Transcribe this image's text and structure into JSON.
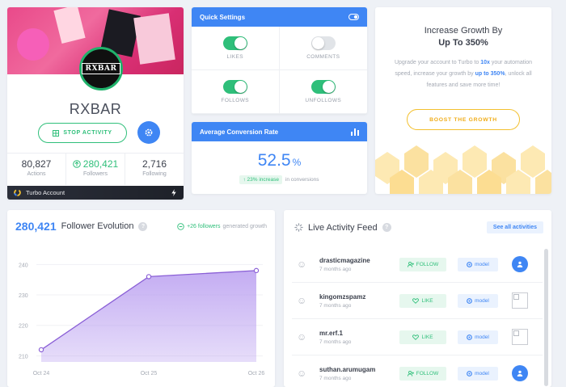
{
  "profile": {
    "logo_text": "RXBAR",
    "name": "RXBAR",
    "stop_label": "STOP ACTIVITY",
    "stats": [
      {
        "value": "80,827",
        "label": "Actions"
      },
      {
        "value": "280,421",
        "label": "Followers"
      },
      {
        "value": "2,716",
        "label": "Following"
      }
    ],
    "turbo_label": "Turbo Account"
  },
  "quick_settings": {
    "title": "Quick Settings",
    "toggles": [
      {
        "label": "LIKES",
        "on": true
      },
      {
        "label": "COMMENTS",
        "on": false
      },
      {
        "label": "FOLLOWS",
        "on": true
      },
      {
        "label": "UNFOLLOWS",
        "on": true
      }
    ]
  },
  "conversion": {
    "title": "Average Conversion Rate",
    "value": "52.5",
    "unit": "%",
    "increase": "23% increase",
    "increase_suffix": "in conversions"
  },
  "upgrade": {
    "title_line1": "Increase Growth By",
    "title_line2": "Up To 350%",
    "text_a": "Upgrade your account to Turbo to ",
    "text_b": "10x",
    "text_c": " your automation speed, increase your growth by ",
    "text_d": "up to 350%",
    "text_e": ", unlock all features and save more time!",
    "button": "BOOST THE GROWTH"
  },
  "evolution": {
    "count": "280,421",
    "title": "Follower Evolution",
    "growth_value": "+26 followers",
    "growth_suffix": "generated growth"
  },
  "chart_data": {
    "type": "area",
    "x": [
      "Oct 24",
      "Oct 25",
      "Oct 26"
    ],
    "values": [
      212,
      236,
      238
    ],
    "yticks": [
      210,
      220,
      230,
      240
    ],
    "ylim": [
      208,
      243
    ],
    "colors": {
      "line": "#8a5fd6",
      "fill": "#b99ef0"
    }
  },
  "feed": {
    "title": "Live Activity Feed",
    "see_all": "See all activities",
    "items": [
      {
        "user": "drasticmagazine",
        "time": "7 months ago",
        "action": "FOLLOW",
        "tag": "model",
        "avatar": "user"
      },
      {
        "user": "kingomzspamz",
        "time": "7 months ago",
        "action": "LIKE",
        "tag": "model",
        "avatar": "image"
      },
      {
        "user": "mr.erf.1",
        "time": "7 months ago",
        "action": "LIKE",
        "tag": "model",
        "avatar": "image"
      },
      {
        "user": "suthan.arumugam",
        "time": "7 months ago",
        "action": "FOLLOW",
        "tag": "model",
        "avatar": "user"
      }
    ]
  }
}
